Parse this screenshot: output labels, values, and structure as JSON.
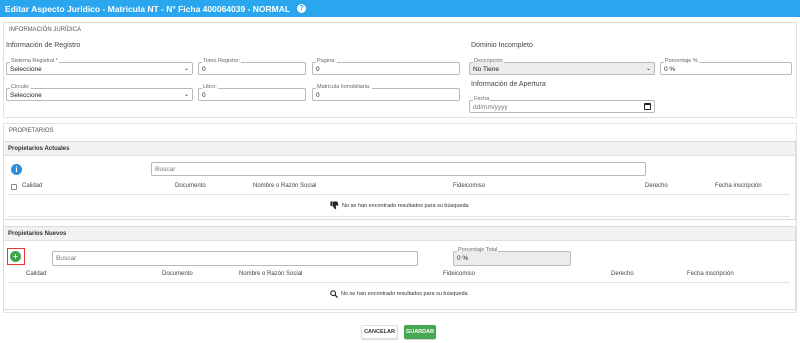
{
  "window": {
    "title": "Editar Aspecto Jurídico - Matricula NT - N° Ficha 400064039 - NORMAL",
    "help_icon": "question-circle-icon"
  },
  "juridica": {
    "section_title": "INFORMACIÓN JURÍDICA",
    "registro_heading": "Información de Registro",
    "dominio_heading": "Dominio Incompleto",
    "apertura_heading": "Información de Apertura",
    "sistema_registral": {
      "label": "Sistema Registral *",
      "value": "Seleccione"
    },
    "tomo_registro": {
      "label": "Tomo Registro:",
      "value": "0"
    },
    "pagina": {
      "label": "Pagina:",
      "value": "0"
    },
    "descripcion": {
      "label": "Descripción",
      "value": "No Tiene"
    },
    "porcentaje": {
      "label": "Porcentaje %",
      "value": "0 %"
    },
    "circulo": {
      "label": "Circulo:",
      "value": "Seleccione"
    },
    "libro": {
      "label": "Libro:",
      "value": "0"
    },
    "matricula_inmobiliaria": {
      "label": "Matricula Inmobiliaria:",
      "value": "0"
    },
    "fecha": {
      "label": "Fecha",
      "placeholder": "dd/mm/yyyy"
    }
  },
  "propietarios": {
    "section_title": "PROPIETARIOS",
    "actuales": {
      "title": "Propietarios Actuales",
      "search_placeholder": "Buscar",
      "columns": [
        "Calidad",
        "Documento",
        "Nombre o Razón Social",
        "Fideicomiso",
        "Derecho",
        "Fecha inscripción"
      ],
      "empty_message": "No se han encontrado resultados para su búsqueda",
      "empty_icon": "thumbs-down-icon"
    },
    "nuevos": {
      "title": "Propietarios Nuevos",
      "search_placeholder": "Buscar",
      "porcentaje_total": {
        "label": "Porcentaje Total",
        "value": "0 %"
      },
      "columns": [
        "Calidad",
        "Documento",
        "Nombre o Razón Social",
        "Fideicomiso",
        "Derecho",
        "Fecha inscripción"
      ],
      "empty_message": "No se han encontrado resultados para su búsqueda",
      "empty_icon": "search-icon"
    }
  },
  "footer": {
    "cancel_label": "CANCELAR",
    "save_label": "GUARDAR"
  },
  "colors": {
    "header": "#29a6ee",
    "info_button": "#2b8fe0",
    "add_button": "#3fa34a",
    "save_button": "#47a652",
    "highlight": "#e53935"
  }
}
